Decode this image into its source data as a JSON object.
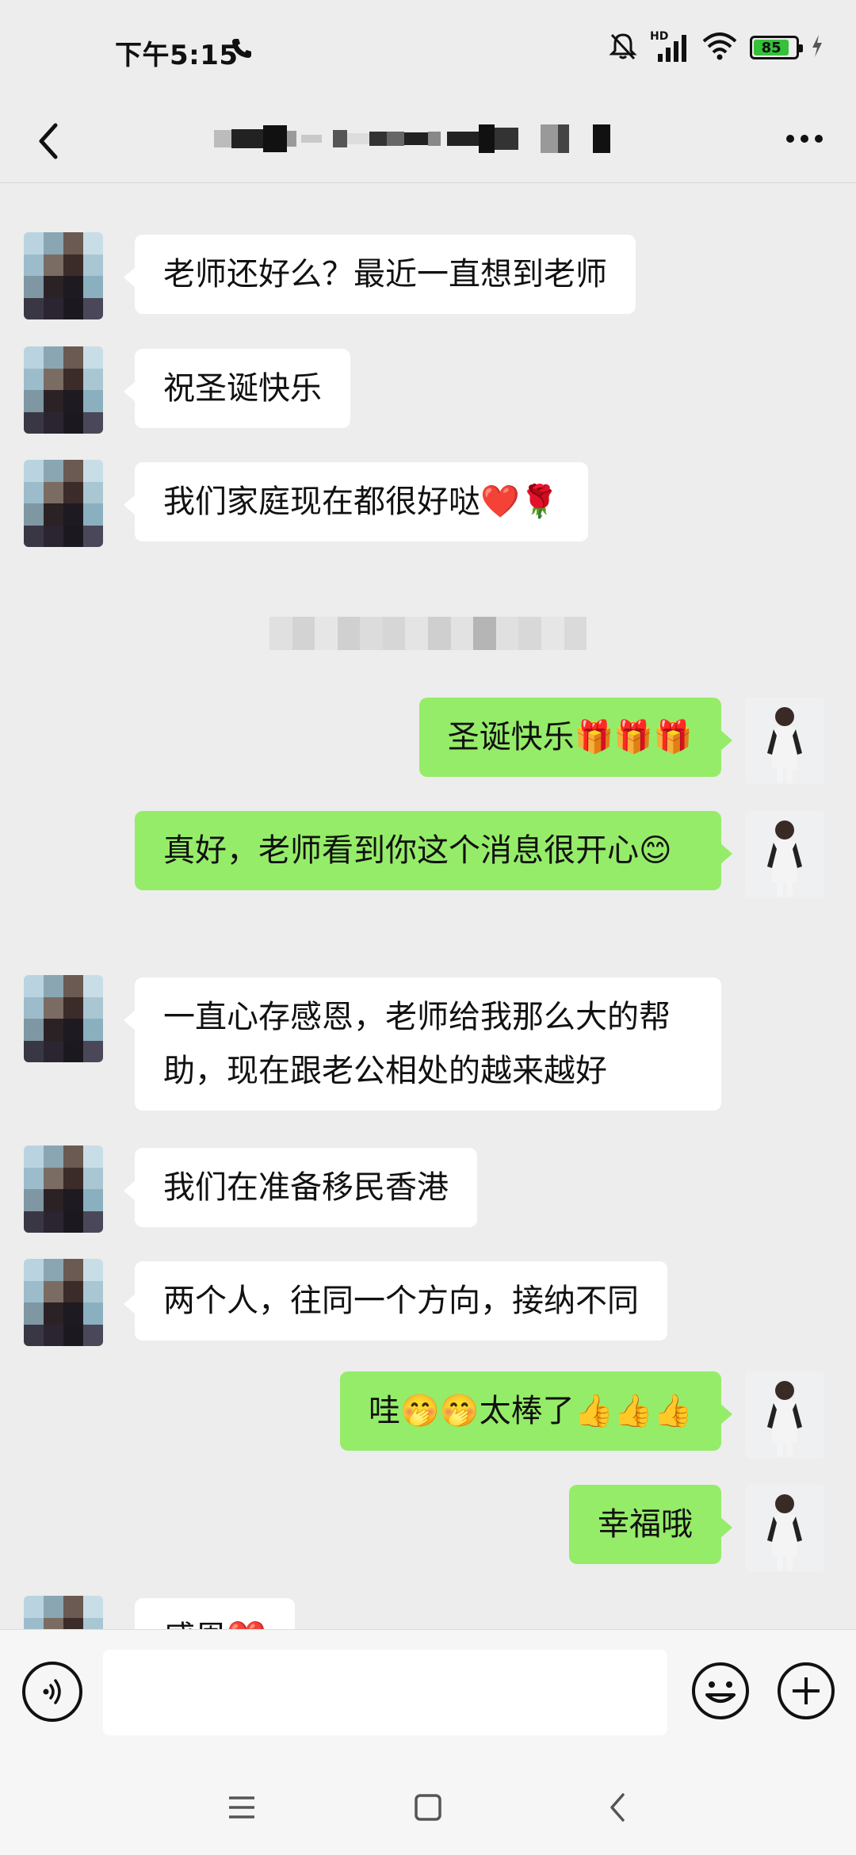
{
  "status_bar": {
    "time": "下午5:15",
    "network_label": "HD",
    "battery": "85"
  },
  "header": {
    "title": "",
    "back_icon": "chevron-left-icon",
    "more_icon": "more-dots-icon"
  },
  "messages": [
    {
      "side": "in",
      "text": "老师还好么？最近一直想到老师"
    },
    {
      "side": "in",
      "text": "祝圣诞快乐"
    },
    {
      "side": "in",
      "text": "我们家庭现在都很好哒❤️🌹"
    },
    {
      "side": "out",
      "text": "圣诞快乐🎁🎁🎁"
    },
    {
      "side": "out",
      "text": "真好，老师看到你这个消息很开心😊"
    },
    {
      "side": "in",
      "text": "一直心存感恩，老师给我那么大的帮助，现在跟老公相处的越来越好"
    },
    {
      "side": "in",
      "text": "我们在准备移民香港"
    },
    {
      "side": "in",
      "text": "两个人，往同一个方向，接纳不同"
    },
    {
      "side": "out",
      "text": "哇🤭🤭太棒了👍👍👍"
    },
    {
      "side": "out",
      "text": "幸福哦"
    },
    {
      "side": "in",
      "text": "感恩❤️"
    }
  ],
  "input_bar": {
    "voice_icon": "voice-icon",
    "placeholder": "",
    "emoji_icon": "emoji-icon",
    "plus_icon": "plus-icon"
  },
  "nav_bar": {
    "items": [
      "menu-icon",
      "home-icon",
      "back-icon"
    ]
  },
  "colors": {
    "background": "#ededed",
    "incoming_bubble": "#ffffff",
    "outgoing_bubble": "#95ec69",
    "battery": "#35c23a"
  }
}
